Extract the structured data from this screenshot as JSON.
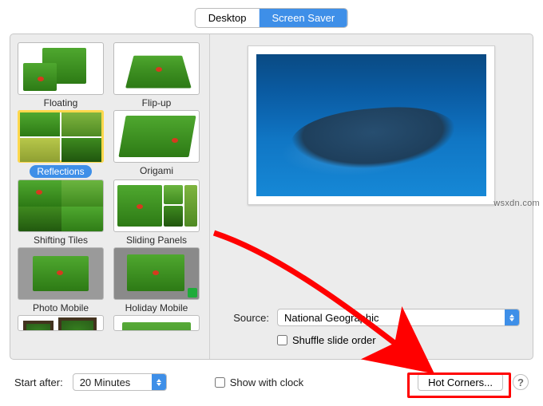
{
  "tabs": {
    "desktop": "Desktop",
    "screen_saver": "Screen Saver"
  },
  "savers": [
    {
      "id": "floating",
      "label": "Floating"
    },
    {
      "id": "flipup",
      "label": "Flip-up"
    },
    {
      "id": "reflections",
      "label": "Reflections",
      "selected": true
    },
    {
      "id": "origami",
      "label": "Origami"
    },
    {
      "id": "shifting_tiles",
      "label": "Shifting Tiles"
    },
    {
      "id": "sliding_panels",
      "label": "Sliding Panels"
    },
    {
      "id": "photo_mobile",
      "label": "Photo Mobile"
    },
    {
      "id": "holiday_mobile",
      "label": "Holiday Mobile"
    }
  ],
  "source": {
    "label": "Source:",
    "value": "National Geographic",
    "shuffle_label": "Shuffle slide order",
    "shuffle_checked": false
  },
  "start_after": {
    "label": "Start after:",
    "value": "20 Minutes"
  },
  "show_clock": {
    "label": "Show with clock",
    "checked": false
  },
  "hot_corners": "Hot Corners...",
  "help": "?",
  "watermark": "wsxdn.com",
  "annotation": {
    "highlight": "hot-corners-button"
  }
}
